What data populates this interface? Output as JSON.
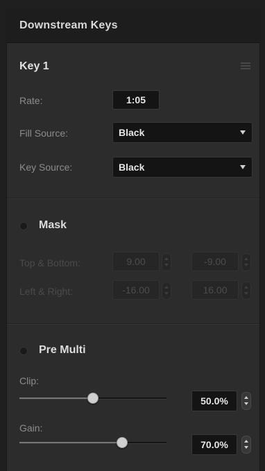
{
  "header": {
    "title": "Downstream Keys"
  },
  "key": {
    "title": "Key 1",
    "menu_icon": "hamburger-menu-icon",
    "rate": {
      "label": "Rate:",
      "value": "1:05"
    },
    "fill_source": {
      "label": "Fill Source:",
      "value": "Black"
    },
    "key_source": {
      "label": "Key Source:",
      "value": "Black"
    }
  },
  "mask": {
    "title": "Mask",
    "enabled": false,
    "top_bottom": {
      "label": "Top & Bottom:",
      "values": [
        "9.00",
        "-9.00"
      ]
    },
    "left_right": {
      "label": "Left & Right:",
      "values": [
        "-16.00",
        "16.00"
      ]
    }
  },
  "pre_multi": {
    "title": "Pre Multi",
    "enabled": false,
    "clip": {
      "label": "Clip:",
      "value": "50.0%",
      "level": 0.5
    },
    "gain": {
      "label": "Gain:",
      "value": "70.0%",
      "level": 0.7
    }
  },
  "colors": {
    "panel_bg": "#2c2c2c",
    "header_bg": "#1d1d1d",
    "field_bg": "#141414"
  }
}
